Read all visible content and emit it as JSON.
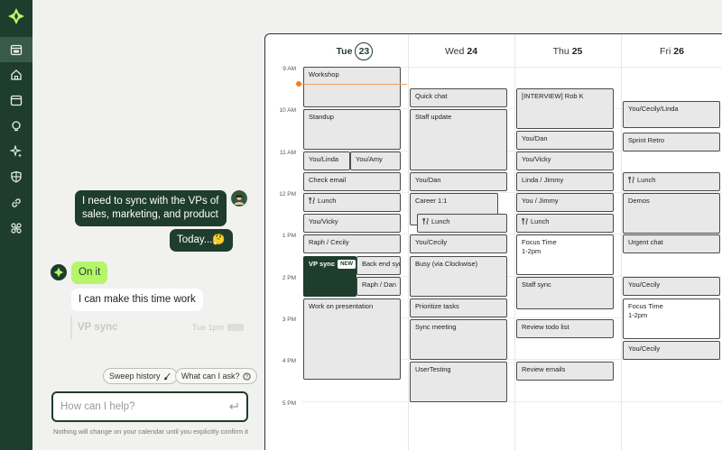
{
  "rail": {
    "nav_icons": [
      "calendar-ai-icon",
      "home-icon",
      "calendar-icon",
      "lightbulb-icon",
      "sparkle-icon",
      "shield-icon",
      "link-icon",
      "integrations-icon"
    ]
  },
  "chat": {
    "user_message_1": "I need to sync with the VPs of sales, marketing, and product",
    "user_message_2": "Today...🤔",
    "bot_message_1": "On it",
    "bot_message_2": "I can make this time work",
    "draft_title": "VP sync",
    "draft_time": "Tue 1pm",
    "chips": {
      "sweep_history": "Sweep history",
      "what_can_i_ask": "What can I ask?"
    },
    "input_placeholder": "How can I help?",
    "disclaimer": "Nothing will change on your calendar until you explicitly confirm it"
  },
  "calendar": {
    "days": [
      {
        "name": "Tue",
        "num": "23",
        "today": true
      },
      {
        "name": "Wed",
        "num": "24"
      },
      {
        "name": "Thu",
        "num": "25"
      },
      {
        "name": "Fri",
        "num": "26"
      }
    ],
    "times": [
      "9 AM",
      "10 AM",
      "11 AM",
      "12 PM",
      "1 PM",
      "2 PM",
      "3 PM",
      "4 PM",
      "5 PM"
    ],
    "new_badge": "NEW",
    "events": {
      "tue": {
        "workshop": "Workshop",
        "standup": "Standup",
        "you_linda": "You/Linda",
        "you_amy": "You/Amy",
        "check_email": "Check email",
        "lunch": "Lunch",
        "you_vicky": "You/Vicky",
        "raph_cecily": "Raph / Cecily",
        "vp_sync": "VP sync",
        "back_end_sync": "Back end sync",
        "raph_dan": "Raph / Dan",
        "work_presentation": "Work on presentation"
      },
      "wed": {
        "quick_chat": "Quick chat",
        "staff_update": "Staff update",
        "you_dan": "You/Dan",
        "career": "Career 1:1",
        "lunch": "Lunch",
        "you_cecily": "You/Cecily",
        "busy": "Busy (via Clockwise)",
        "prioritize": "Prioritize tasks",
        "sync_meeting": "Sync meeting",
        "usertesting": "UserTesting"
      },
      "thu": {
        "interview": "[INTERVIEW] Rob K",
        "you_dan": "You/Dan",
        "you_vicky": "You/Vicky",
        "linda_jimmy": "Linda / Jimmy",
        "you_jimmy": "You / Jimmy",
        "lunch": "Lunch",
        "focus_title": "Focus Time",
        "focus_time": "1-2pm",
        "staff_sync": "Staff sync",
        "review_todo": "Review todo list",
        "review_emails": "Review emails"
      },
      "fri": {
        "you_cecily_linda": "You/Cecily/Linda",
        "sprint_retro": "Sprint Retro",
        "lunch": "Lunch",
        "demos": "Demos",
        "urgent_chat": "Urgent chat",
        "you_cecily": "You/Cecily",
        "focus_title": "Focus Time",
        "focus_time": "1-2pm",
        "you_cecily_2": "You/Cecily"
      }
    }
  }
}
